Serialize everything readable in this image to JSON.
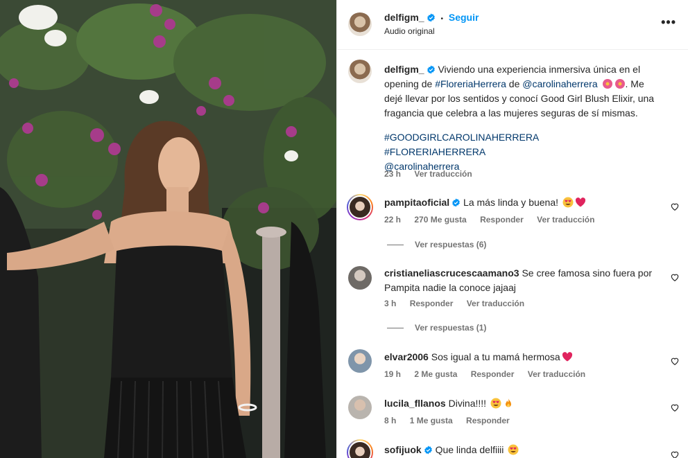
{
  "header": {
    "username": "delfigm_",
    "separator": "•",
    "follow_label": "Seguir",
    "subtitle": "Audio original",
    "more_label": "•••"
  },
  "caption": {
    "username": "delfigm_",
    "text_1": "Viviendo una experiencia inmersiva única en el opening de",
    "tag_floreria": "#FloreriaHerrera",
    "text_de": "de",
    "mention_carolina": "@carolinaherrera",
    "text_2": ". Me dejé llevar por los sentidos y conocí Good Girl Blush Elixir, una fragancia que celebra a las mujeres seguras de sí mismas.",
    "hashtag_1": "#GOODGIRLCAROLINAHERRERA",
    "hashtag_2": "#FLORERIAHERRERA",
    "mention_2": "@carolinaherrera",
    "time": "23 h",
    "translate": "Ver traducción"
  },
  "comments": [
    {
      "username": "pampitaoficial",
      "verified": true,
      "text": "La más linda y buena!",
      "time": "22 h",
      "likes": "270 Me gusta",
      "reply": "Responder",
      "translate": "Ver traducción",
      "replies_label": "Ver respuestas (6)"
    },
    {
      "username": "cristianeliascrucescaamano3",
      "verified": false,
      "text": "Se cree famosa sino fuera por Pampita nadie la conoce jajaaj",
      "time": "3 h",
      "reply": "Responder",
      "translate": "Ver traducción",
      "replies_label": "Ver respuestas (1)"
    },
    {
      "username": "elvar2006",
      "verified": false,
      "text": "Sos igual a tu mamá hermosa",
      "time": "19 h",
      "likes": "2 Me gusta",
      "reply": "Responder",
      "translate": "Ver traducción"
    },
    {
      "username": "lucila_fllanos",
      "verified": false,
      "text": "Divina!!!!",
      "time": "8 h",
      "likes": "1 Me gusta",
      "reply": "Responder"
    },
    {
      "username": "sofijuok",
      "verified": true,
      "text": "Que linda delfiiii"
    }
  ],
  "colors": {
    "link": "#00376b",
    "follow": "#0095f6",
    "verified": "#0095f6",
    "muted": "#737373"
  }
}
